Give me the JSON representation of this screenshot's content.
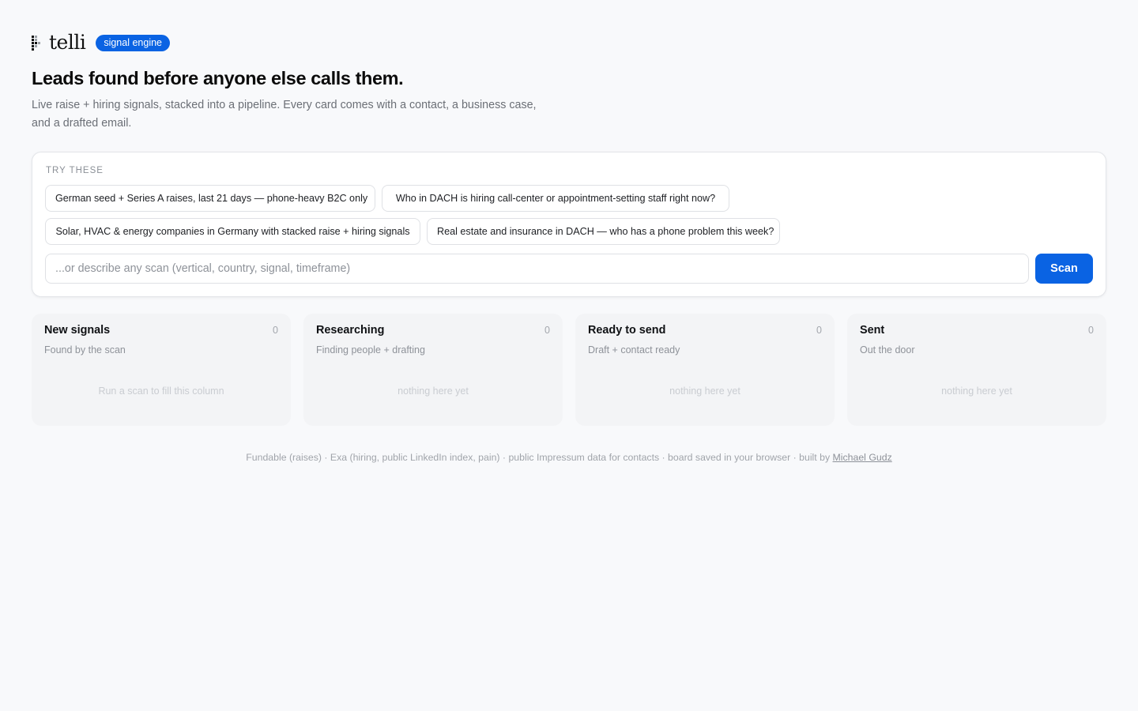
{
  "brand": {
    "name": "telli",
    "badge": "signal engine"
  },
  "hero": {
    "title": "Leads found before anyone else calls them.",
    "subtitle": "Live raise + hiring signals, stacked into a pipeline. Every card comes with a contact, a business case, and a drafted email."
  },
  "search": {
    "try_label": "TRY THESE",
    "suggestions": [
      "German seed + Series A raises, last 21 days — phone-heavy B2C only",
      "Who in DACH is hiring call-center or appointment-setting staff right now?",
      "Solar, HVAC & energy companies in Germany with stacked raise + hiring signals",
      "Real estate and insurance in DACH — who has a phone problem this week?"
    ],
    "input_value": "",
    "placeholder": "...or describe any scan (vertical, country, signal, timeframe)",
    "button_label": "Scan"
  },
  "board": {
    "columns": [
      {
        "title": "New signals",
        "count": "0",
        "subtitle": "Found by the scan",
        "empty": "Run a scan to fill this column"
      },
      {
        "title": "Researching",
        "count": "0",
        "subtitle": "Finding people + drafting",
        "empty": "nothing here yet"
      },
      {
        "title": "Ready to send",
        "count": "0",
        "subtitle": "Draft + contact ready",
        "empty": "nothing here yet"
      },
      {
        "title": "Sent",
        "count": "0",
        "subtitle": "Out the door",
        "empty": "nothing here yet"
      }
    ]
  },
  "footer": {
    "text": "Fundable (raises) · Exa (hiring, public LinkedIn index, pain) · public Impressum data for contacts · board saved in your browser · built by ",
    "author_link": "Michael Gudz"
  },
  "colors": {
    "accent": "#0a63e3",
    "background": "#f8f9fb"
  }
}
